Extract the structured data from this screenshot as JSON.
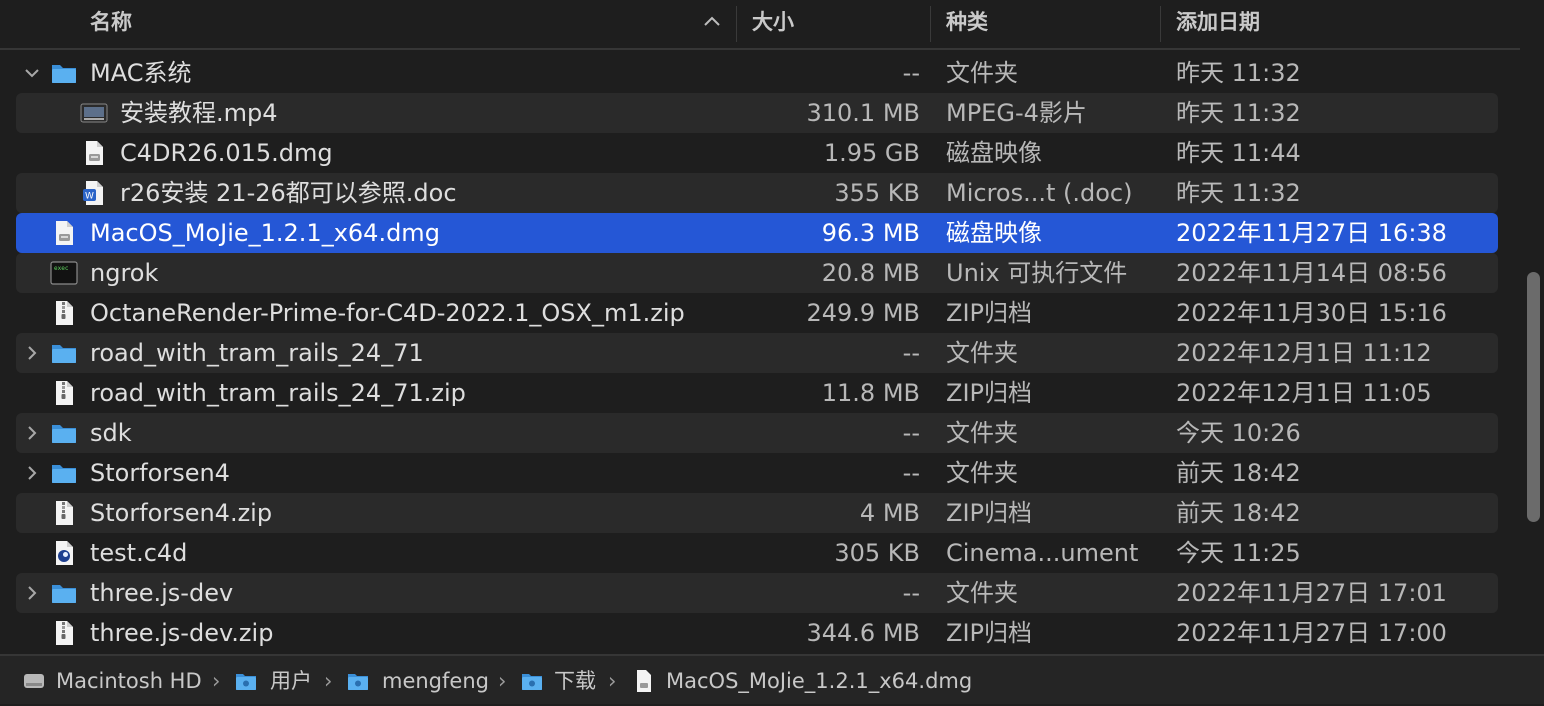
{
  "header": {
    "name": "名称",
    "size": "大小",
    "kind": "种类",
    "date_added": "添加日期"
  },
  "rows": [
    {
      "name": "MAC系统",
      "size": "--",
      "kind": "文件夹",
      "date": "昨天 11:32",
      "icon": "folder-icon",
      "disclosure": "expanded"
    },
    {
      "name": "安装教程.mp4",
      "size": "310.1 MB",
      "kind": "MPEG-4影片",
      "date": "昨天 11:32",
      "icon": "video-file-icon"
    },
    {
      "name": "C4DR26.015.dmg",
      "size": "1.95 GB",
      "kind": "磁盘映像",
      "date": "昨天 11:44",
      "icon": "disk-image-icon"
    },
    {
      "name": "r26安装 21-26都可以参照.doc",
      "size": "355 KB",
      "kind": "Micros...t (.doc)",
      "date": "昨天 11:32",
      "icon": "word-document-icon"
    },
    {
      "name": "MacOS_MoJie_1.2.1_x64.dmg",
      "size": "96.3 MB",
      "kind": "磁盘映像",
      "date": "2022年11月27日 16:38",
      "icon": "disk-image-icon",
      "selected": true
    },
    {
      "name": "ngrok",
      "size": "20.8 MB",
      "kind": "Unix 可执行文件",
      "date": "2022年11月14日 08:56",
      "icon": "terminal-executable-icon"
    },
    {
      "name": "OctaneRender-Prime-for-C4D-2022.1_OSX_m1.zip",
      "size": "249.9 MB",
      "kind": "ZIP归档",
      "date": "2022年11月30日 15:16",
      "icon": "zip-file-icon"
    },
    {
      "name": "road_with_tram_rails_24_71",
      "size": "--",
      "kind": "文件夹",
      "date": "2022年12月1日 11:12",
      "icon": "folder-icon",
      "disclosure": "collapsed"
    },
    {
      "name": "road_with_tram_rails_24_71.zip",
      "size": "11.8 MB",
      "kind": "ZIP归档",
      "date": "2022年12月1日 11:05",
      "icon": "zip-file-icon"
    },
    {
      "name": "sdk",
      "size": "--",
      "kind": "文件夹",
      "date": "今天 10:26",
      "icon": "folder-icon",
      "disclosure": "collapsed"
    },
    {
      "name": "Storforsen4",
      "size": "--",
      "kind": "文件夹",
      "date": "前天 18:42",
      "icon": "folder-icon",
      "disclosure": "collapsed"
    },
    {
      "name": "Storforsen4.zip",
      "size": "4 MB",
      "kind": "ZIP归档",
      "date": "前天 18:42",
      "icon": "zip-file-icon"
    },
    {
      "name": "test.c4d",
      "size": "305 KB",
      "kind": "Cinema...ument",
      "date": "今天 11:25",
      "icon": "cinema4d-file-icon"
    },
    {
      "name": "three.js-dev",
      "size": "--",
      "kind": "文件夹",
      "date": "2022年11月27日 17:01",
      "icon": "folder-icon",
      "disclosure": "collapsed"
    },
    {
      "name": "three.js-dev.zip",
      "size": "344.6 MB",
      "kind": "ZIP归档",
      "date": "2022年11月27日 17:00",
      "icon": "zip-file-icon"
    }
  ],
  "pathbar": [
    {
      "label": "Macintosh HD",
      "icon": "hard-drive-icon"
    },
    {
      "label": "用户",
      "icon": "users-folder-icon"
    },
    {
      "label": "mengfeng",
      "icon": "home-folder-icon"
    },
    {
      "label": "下载",
      "icon": "downloads-folder-icon"
    },
    {
      "label": "MacOS_MoJie_1.2.1_x64.dmg",
      "icon": "disk-image-icon"
    }
  ],
  "colors": {
    "background": "#1e1e1e",
    "selection": "#2557d6",
    "folder": "#4aa3e8"
  }
}
